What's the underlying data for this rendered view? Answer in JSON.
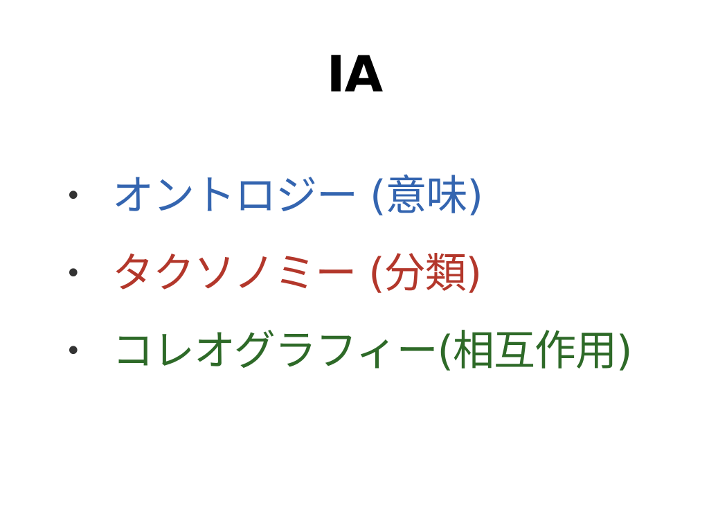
{
  "slide": {
    "title": "IA",
    "bullet_symbol": "•",
    "items": [
      {
        "text": "オントロジー (意味)",
        "color": "#3465b0"
      },
      {
        "text": "タクソノミー (分類)",
        "color": "#b3372b"
      },
      {
        "text": "コレオグラフィー(相互作用)",
        "color": "#2e6a28"
      }
    ]
  }
}
